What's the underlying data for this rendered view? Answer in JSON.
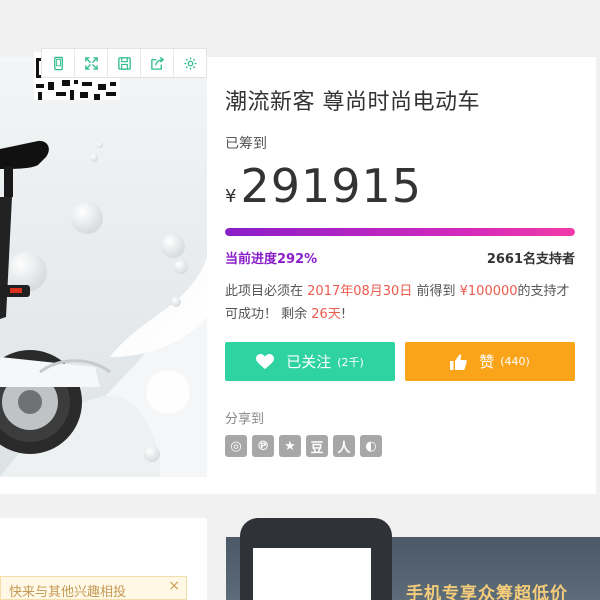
{
  "toolbar": {
    "icons": [
      "phone-icon",
      "fullscreen-icon",
      "save-icon",
      "share-out-icon",
      "settings-icon"
    ],
    "accent": "#2ebc8f"
  },
  "project": {
    "title": "潮流新客 尊尚时尚电动车",
    "raised_label": "已筹到",
    "currency": "¥",
    "amount": "291915",
    "progress_label": "当前进度292%",
    "progress_fraction": 1.0,
    "supporters": "2661名支持者",
    "desc_1": "此项目必须在",
    "deadline": "2017年08月30日",
    "desc_2": "前得到",
    "goal": "¥100000",
    "desc_3": "的支持才可成功！ 剩余",
    "days_left": "26天",
    "desc_4": "!"
  },
  "actions": {
    "follow_label": "已关注",
    "follow_count": "(2千)",
    "like_label": "赞",
    "like_count": "(440)"
  },
  "share": {
    "label": "分享到",
    "icons": [
      "weibo-icon",
      "pinterest-icon",
      "star-icon",
      "douban-icon",
      "renren-icon",
      "wechat-icon"
    ],
    "glyphs": [
      "◎",
      "℗",
      "★",
      "豆",
      "人",
      "◐"
    ]
  },
  "tip": {
    "text": "快来与其他兴趣相投",
    "close": "×"
  },
  "banner": {
    "text": "手机专享众筹超低价"
  },
  "colors": {
    "follow": "#2ed3a1",
    "like": "#faa41a",
    "progress_start": "#8a1ec9",
    "progress_end": "#f13ca8",
    "highlight": "#ec5a4e"
  }
}
